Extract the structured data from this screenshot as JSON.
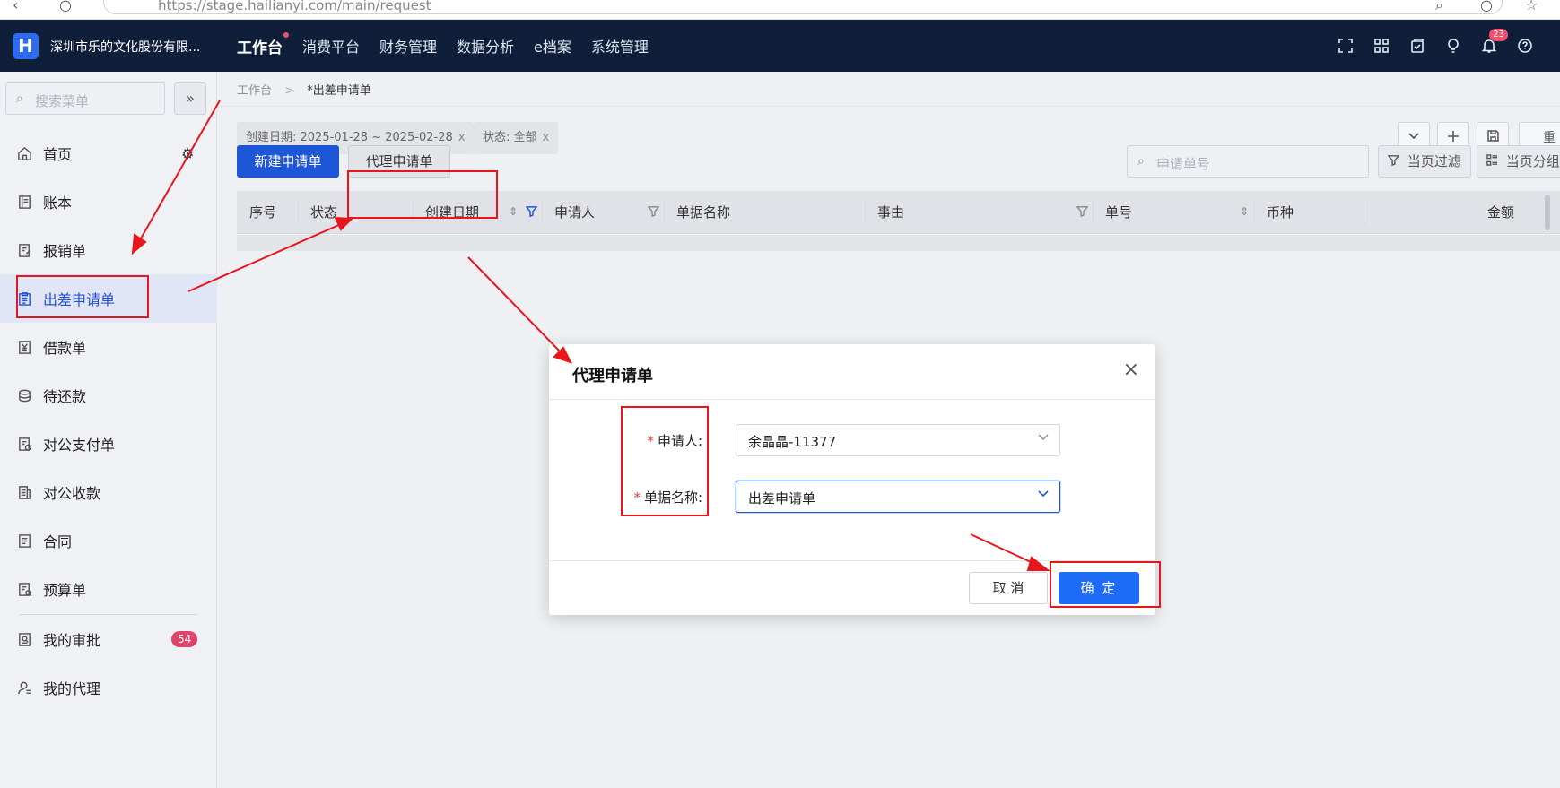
{
  "browser": {
    "url": "https://stage.hailianyi.com/main/request"
  },
  "topnav": {
    "logo_letter": "H",
    "company": "深圳市乐的文化股份有限...",
    "menu": [
      "工作台",
      "消费平台",
      "财务管理",
      "数据分析",
      "e档案",
      "系统管理"
    ],
    "active_index": 0,
    "notification_count": "23"
  },
  "sidebar": {
    "search_placeholder": "搜索菜单",
    "collapse_glyph": "»",
    "items": [
      {
        "label": "首页",
        "icon": "home-icon"
      },
      {
        "label": "账本",
        "icon": "ledger-icon"
      },
      {
        "label": "报销单",
        "icon": "reimburse-icon"
      },
      {
        "label": "出差申请单",
        "icon": "clipboard-icon",
        "active": true
      },
      {
        "label": "借款单",
        "icon": "yen-icon"
      },
      {
        "label": "待还款",
        "icon": "repay-icon"
      },
      {
        "label": "对公支付单",
        "icon": "payment-icon"
      },
      {
        "label": "对公收款",
        "icon": "receipt-icon"
      },
      {
        "label": "合同",
        "icon": "contract-icon"
      },
      {
        "label": "预算单",
        "icon": "budget-icon"
      },
      {
        "label": "我的审批",
        "icon": "approval-icon",
        "badge": "54"
      },
      {
        "label": "我的代理",
        "icon": "agent-icon"
      }
    ]
  },
  "breadcrumb": {
    "root": "工作台",
    "sep": ">",
    "current": "*出差申请单"
  },
  "filters": {
    "chips": [
      "创建日期: 2025-01-28 ~ 2025-02-28",
      "状态: 全部"
    ],
    "remove_glyph": "x",
    "reset_label": "重"
  },
  "toolbar": {
    "new_label": "新建申请单",
    "proxy_label": "代理申请单",
    "search_placeholder": "申请单号",
    "page_filter_label": "当页过滤",
    "page_group_label": "当页分组"
  },
  "table": {
    "columns": [
      "序号",
      "状态",
      "创建日期",
      "申请人",
      "单据名称",
      "事由",
      "单号",
      "币种",
      "金额"
    ]
  },
  "dialog": {
    "title": "代理申请单",
    "close_glyph": "×",
    "fields": [
      {
        "label": "申请人:",
        "value": "余晶晶-11377",
        "required": true
      },
      {
        "label": "单据名称:",
        "value": "出差申请单",
        "required": true,
        "focused": true
      }
    ],
    "required_mark": "*",
    "cancel_label": "取 消",
    "ok_label": "确 定"
  },
  "colors": {
    "nav_bg": "#0f1f3a",
    "primary": "#1e56d8",
    "active_sidebar_text": "#2453d6",
    "annotation_red": "#e8161b",
    "badge": "#e0436a"
  }
}
